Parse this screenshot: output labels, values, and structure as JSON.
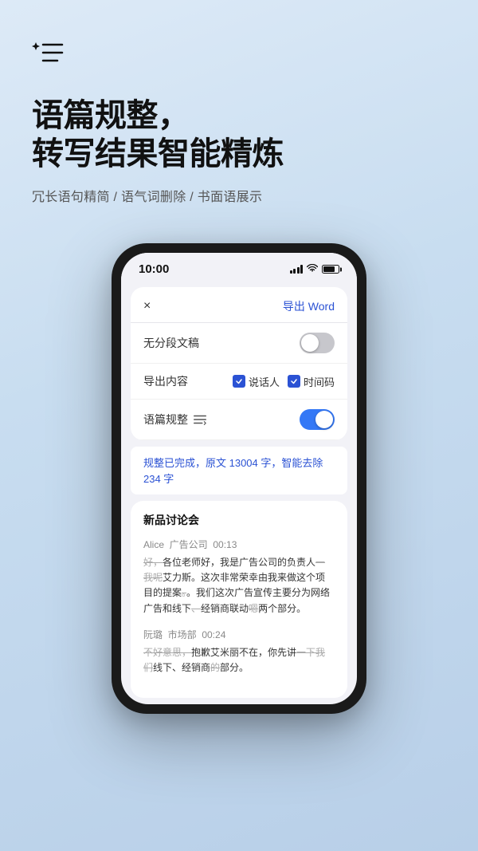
{
  "page": {
    "background": "linear-gradient(160deg, #ddeaf7 0%, #c8ddf0 40%, #b8cfe8 100%)"
  },
  "header": {
    "title_line1": "语篇规整，",
    "title_line2": "转写结果智能精炼",
    "subtitle": "冗长语句精简 / 语气词删除 / 书面语展示"
  },
  "phone": {
    "status_bar": {
      "time": "10:00"
    },
    "modal": {
      "close_icon": "×",
      "export_button": "导出 Word",
      "row1_label": "无分段文稿",
      "row1_toggle": "off",
      "row2_label": "导出内容",
      "checkbox1_label": "说话人",
      "checkbox2_label": "时间码",
      "row3_label": "语篇规整",
      "row3_toggle": "on"
    },
    "info_banner": {
      "text": "规整已完成，原文 13004 字，智能去除 234 字"
    },
    "transcript": {
      "title": "新品讨论会",
      "blocks": [
        {
          "speaker": "Alice  广告公司  00:13",
          "lines": [
            {
              "strikethrough": true,
              "text": "好，"
            },
            {
              "strikethrough": false,
              "text": "各位老师好，我是广告公司的负责人"
            },
            {
              "strikethrough": true,
              "text": "一我呢"
            },
            {
              "strikethrough": false,
              "text": "艾力斯。这次非常荣幸由我来做这个项目的提案"
            },
            {
              "strikethrough": true,
              "text": "。"
            },
            {
              "strikethrough": false,
              "text": "。我们这次广告宣传主要分为网络广告和线下"
            },
            {
              "strikethrough": true,
              "text": "、"
            },
            {
              "strikethrough": false,
              "text": "经销商联动"
            },
            {
              "strikethrough": true,
              "text": "嗯"
            },
            {
              "strikethrough": false,
              "text": "两个部分。"
            }
          ]
        },
        {
          "speaker": "阮璐  市场部  00:24",
          "lines": [
            {
              "strikethrough": true,
              "text": "不好意思，"
            },
            {
              "strikethrough": false,
              "text": "抱歉艾米丽不在，你先讲"
            },
            {
              "strikethrough": true,
              "text": "一下我们"
            },
            {
              "strikethrough": false,
              "text": "线下、经销商"
            },
            {
              "strikethrough": true,
              "text": "的"
            },
            {
              "strikethrough": false,
              "text": "部分。"
            }
          ]
        }
      ]
    }
  }
}
